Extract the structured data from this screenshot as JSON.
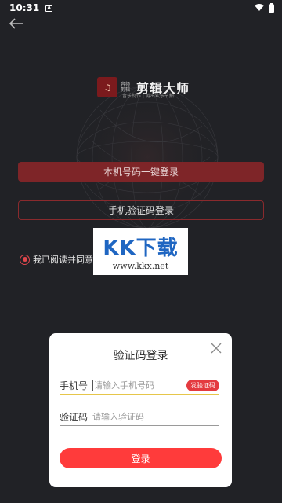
{
  "status_bar": {
    "time": "10:31",
    "notif_letter": "A"
  },
  "logo": {
    "small_text": "音频剪辑",
    "name": "剪辑大师",
    "slogan": "音乐制作 | 剪出欢乐节拍"
  },
  "buttons": {
    "one_key_login": "本机号码一键登录",
    "sms_login": "手机验证码登录"
  },
  "agreement": {
    "text": "我已阅读并同意"
  },
  "watermark": {
    "brand": "KK下载",
    "url": "www.kkx.net"
  },
  "dialog": {
    "title": "验证码登录",
    "phone_label": "手机号",
    "phone_placeholder": "请输入手机号码",
    "send_code": "发验证码",
    "code_label": "验证码",
    "code_placeholder": "请输入验证码",
    "login": "登录"
  },
  "colors": {
    "accent": "#ff3b3b",
    "background": "#212226"
  }
}
